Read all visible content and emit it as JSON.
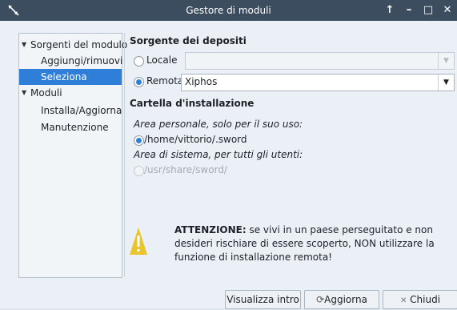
{
  "window": {
    "title": "Gestore di moduli",
    "controls": {
      "keep_above": "↑",
      "minimize": "–",
      "maximize": "□",
      "close": "✕"
    }
  },
  "sidebar": {
    "items": [
      {
        "label": "Sorgenti del modulo",
        "expanded": true,
        "level": 0
      },
      {
        "label": "Aggiungi/rimuovi",
        "level": 1
      },
      {
        "label": "Seleziona",
        "level": 1,
        "selected": true
      },
      {
        "label": "Moduli",
        "expanded": true,
        "level": 0
      },
      {
        "label": "Installa/Aggiorna",
        "level": 1
      },
      {
        "label": "Manutenzione",
        "level": 1
      }
    ]
  },
  "repo_source": {
    "heading": "Sorgente dei depositi",
    "local_label": "Locale",
    "local_value": "",
    "remote_label": "Remota",
    "remote_value": "Xiphos"
  },
  "install_folder": {
    "heading": "Cartella d'installazione",
    "personal_caption": "Area personale, solo per il suo uso:",
    "personal_path": "/home/vittorio/.sword",
    "system_caption": "Area di sistema, per tutti gli utenti:",
    "system_path": "/usr/share/sword/"
  },
  "warning": {
    "bold": "ATTENZIONE:",
    "text": " se vivi in un paese perseguitato e non desideri rischiare di essere scoperto, NON utilizzare la funzione di installazione remota!"
  },
  "buttons": {
    "intro": "Visualizza intro",
    "refresh": "Aggiorna",
    "close": "Chiudi"
  },
  "colors": {
    "titlebar": "#3d4d60",
    "accent": "#2f7fd8",
    "warning_icon": "#e8c52c"
  }
}
